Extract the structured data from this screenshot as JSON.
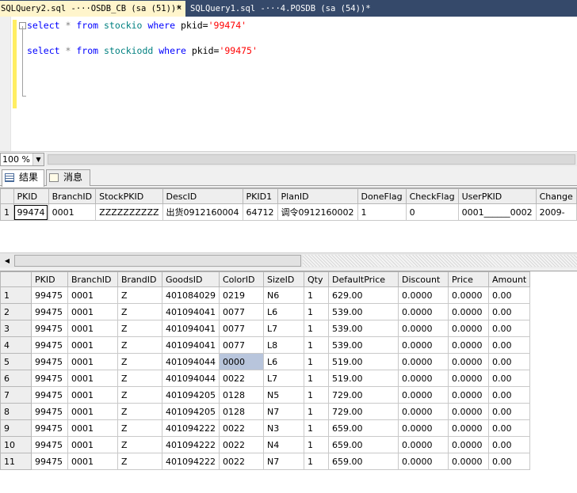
{
  "tabs": [
    {
      "label": "SQLQuery2.sql -···OSDB_CB (sa (51))*",
      "close": "×"
    },
    {
      "label": "SQLQuery1.sql -···4.POSDB (sa (54))*"
    }
  ],
  "editor": {
    "line1": {
      "kw1": "select",
      "star": "*",
      "kw2": "from",
      "table": "stockio",
      "kw3": "where",
      "col": "pkid=",
      "value": "'99474'"
    },
    "line2": {
      "kw1": "select",
      "star": "*",
      "kw2": "from",
      "table": "stockiodd",
      "kw3": "where",
      "col": "pkid=",
      "value": "'99475'"
    }
  },
  "zoom": {
    "value": "100 %"
  },
  "result_tabs": [
    {
      "label": "结果",
      "icon": "grid-icon"
    },
    {
      "label": "消息",
      "icon": "message-icon"
    }
  ],
  "grid1": {
    "columns": [
      "PKID",
      "BranchID",
      "StockPKID",
      "DescID",
      "PKID1",
      "PlanID",
      "DoneFlag",
      "CheckFlag",
      "UserPKID",
      "Change"
    ],
    "rows": [
      {
        "n": "1",
        "cells": [
          "99474",
          "0001",
          "ZZZZZZZZZZ",
          "出货0912160004",
          "64712",
          "调令0912160002",
          "1",
          "0",
          "0001______0002",
          "2009-"
        ]
      }
    ]
  },
  "grid2": {
    "columns": [
      "PKID",
      "BranchID",
      "BrandID",
      "GoodsID",
      "ColorID",
      "SizeID",
      "Qty",
      "DefaultPrice",
      "Discount",
      "Price",
      "Amount"
    ],
    "rows": [
      {
        "n": "1",
        "cells": [
          "99475",
          "0001",
          "Z",
          "401084029",
          "0219",
          "N6",
          "1",
          "629.00",
          "0.0000",
          "0.0000",
          "0.00"
        ]
      },
      {
        "n": "2",
        "cells": [
          "99475",
          "0001",
          "Z",
          "401094041",
          "0077",
          "L6",
          "1",
          "539.00",
          "0.0000",
          "0.0000",
          "0.00"
        ]
      },
      {
        "n": "3",
        "cells": [
          "99475",
          "0001",
          "Z",
          "401094041",
          "0077",
          "L7",
          "1",
          "539.00",
          "0.0000",
          "0.0000",
          "0.00"
        ]
      },
      {
        "n": "4",
        "cells": [
          "99475",
          "0001",
          "Z",
          "401094041",
          "0077",
          "L8",
          "1",
          "539.00",
          "0.0000",
          "0.0000",
          "0.00"
        ]
      },
      {
        "n": "5",
        "cells": [
          "99475",
          "0001",
          "Z",
          "401094044",
          "0000",
          "L6",
          "1",
          "519.00",
          "0.0000",
          "0.0000",
          "0.00"
        ]
      },
      {
        "n": "6",
        "cells": [
          "99475",
          "0001",
          "Z",
          "401094044",
          "0022",
          "L7",
          "1",
          "519.00",
          "0.0000",
          "0.0000",
          "0.00"
        ]
      },
      {
        "n": "7",
        "cells": [
          "99475",
          "0001",
          "Z",
          "401094205",
          "0128",
          "N5",
          "1",
          "729.00",
          "0.0000",
          "0.0000",
          "0.00"
        ]
      },
      {
        "n": "8",
        "cells": [
          "99475",
          "0001",
          "Z",
          "401094205",
          "0128",
          "N7",
          "1",
          "729.00",
          "0.0000",
          "0.0000",
          "0.00"
        ]
      },
      {
        "n": "9",
        "cells": [
          "99475",
          "0001",
          "Z",
          "401094222",
          "0022",
          "N3",
          "1",
          "659.00",
          "0.0000",
          "0.0000",
          "0.00"
        ]
      },
      {
        "n": "10",
        "cells": [
          "99475",
          "0001",
          "Z",
          "401094222",
          "0022",
          "N4",
          "1",
          "659.00",
          "0.0000",
          "0.0000",
          "0.00"
        ]
      },
      {
        "n": "11",
        "cells": [
          "99475",
          "0001",
          "Z",
          "401094222",
          "0022",
          "N7",
          "1",
          "659.00",
          "0.0000",
          "0.0000",
          "0.00"
        ]
      }
    ]
  },
  "colors": {
    "tabbar": "#35496a",
    "active_tab": "#fff5cc",
    "selected_cell": "#b8c5dc",
    "keyword": "#0000ff",
    "table_name": "#008080",
    "string": "#ff0000"
  }
}
